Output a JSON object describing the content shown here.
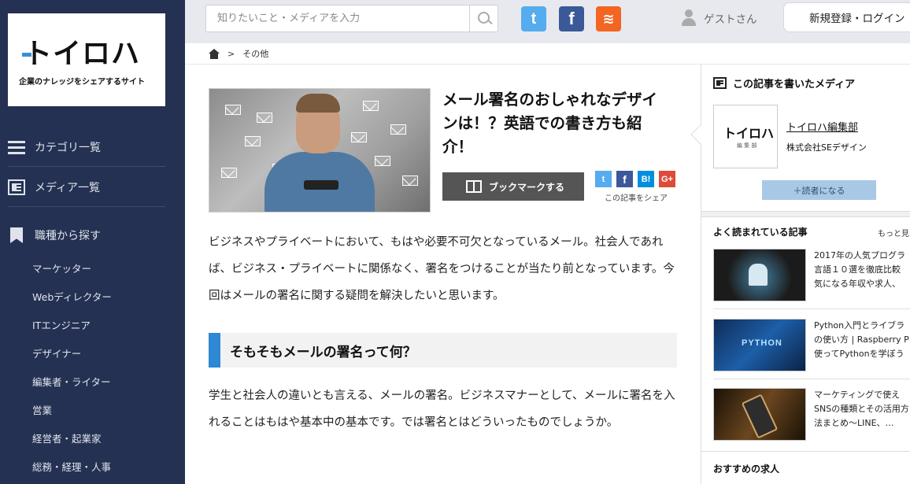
{
  "logo": {
    "mark": "トイロハ",
    "tagline": "企業のナレッジをシェアするサイト"
  },
  "sidebar": {
    "nav": [
      {
        "label": "カテゴリ一覧",
        "icon": "list-icon"
      },
      {
        "label": "メディア一覧",
        "icon": "media-icon"
      },
      {
        "label": "職種から探す",
        "icon": "bookmark-icon"
      }
    ],
    "jobs": [
      "マーケッター",
      "Webディレクター",
      "ITエンジニア",
      "デザイナー",
      "編集者・ライター",
      "営業",
      "経営者・起業家",
      "総務・経理・人事"
    ]
  },
  "header": {
    "search_placeholder": "知りたいこと・メディアを入力",
    "sns": [
      {
        "icon": "twitter-icon",
        "glyph": "t",
        "color": "#55acee"
      },
      {
        "icon": "facebook-icon",
        "glyph": "f",
        "color": "#3b5998"
      },
      {
        "icon": "rss-icon",
        "glyph": "≋",
        "color": "#f26522"
      }
    ],
    "guest": "ゲストさん",
    "signup": "新規登録・ログイン"
  },
  "breadcrumb": {
    "separator": ">",
    "current": "その他"
  },
  "article": {
    "title": "メール署名のおしゃれなデザインは！？英語での書き方も紹介！",
    "bookmark_label": "ブックマークする",
    "share": {
      "twitter": "t",
      "facebook": "f",
      "hatena": "B!",
      "google": "G+",
      "label": "この記事をシェア"
    },
    "para1": "ビジネスやプライベートにおいて、もはや必要不可欠となっているメール。社会人であれば、ビジネス・プライベートに関係なく、署名をつけることが当たり前となっています。今回はメールの署名に関する疑問を解決したいと思います。",
    "section_heading": "そもそもメールの署名って何？",
    "para2": "学生と社会人の違いとも言える、メールの署名。ビジネスマナーとして、メールに署名を入れることはもはや基本中の基本です。では署名とはどういったものでしょうか。"
  },
  "right": {
    "media_heading": "この記事を書いたメディア",
    "media_logo": "トイロハ",
    "media_logo_sub": "編 集 部",
    "media_name": "トイロハ編集部",
    "media_company": "株式会社SEデザイン",
    "follow": "＋読者になる",
    "popular_heading": "よく読まれている記事",
    "popular_more": "もっと見",
    "popular": [
      {
        "lines": [
          "2017年の人気プログラ",
          "言語１０選を徹底比較",
          "気になる年収や求人、"
        ]
      },
      {
        "lines": [
          "Python入門とライブラ",
          "の使い方 | Raspberry P",
          "使ってPythonを学ぼう"
        ],
        "thumb_label": "PYTHON"
      },
      {
        "lines": [
          "マーケティングで使え",
          "SNSの種類とその活用方",
          "法まとめ〜LINE、…"
        ]
      }
    ],
    "jobs_heading": "おすすめの求人"
  }
}
